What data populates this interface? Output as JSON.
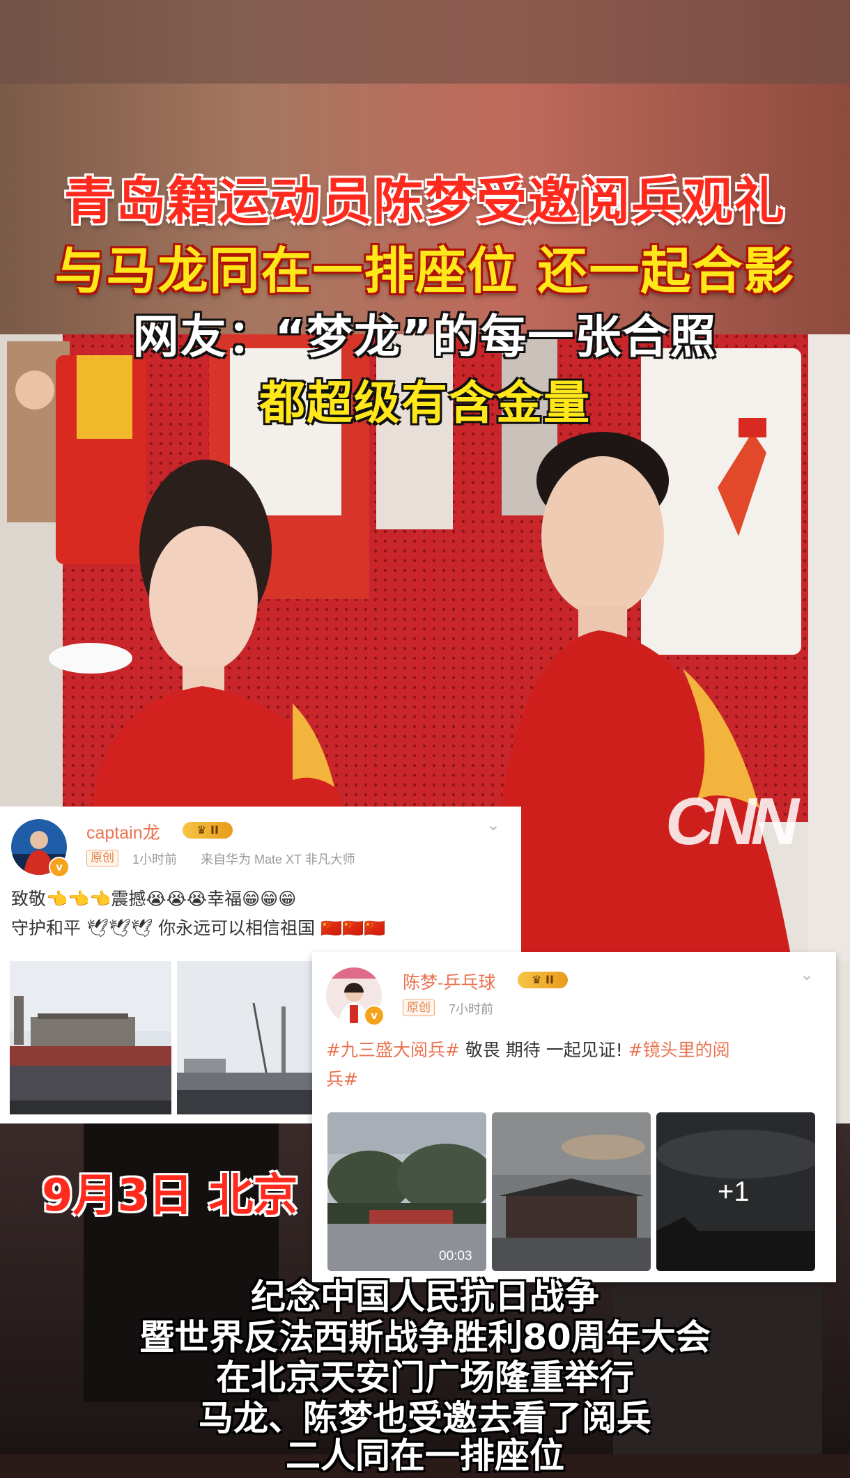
{
  "headline": {
    "line1": "青岛籍运动员陈梦受邀阅兵观礼",
    "line2": "与马龙同在一排座位 还一起合影",
    "line3": "网友：“梦龙”的每一张合照",
    "line4": "都超级有含金量"
  },
  "watermark": "CNN",
  "post1": {
    "username": "captain龙",
    "vip_level": "II",
    "verified_badge": "v",
    "original_tag": "原创",
    "time": "1小时前",
    "source": "来自华为 Mate XT 非凡大师",
    "line1_prefix": "致敬",
    "line1_emoji_a": "👈👈👈",
    "line1_mid": "震撼",
    "line1_emoji_b": "😭😭😭",
    "line1_mid2": "幸福",
    "line1_emoji_c": "😁😁😁",
    "line2_prefix": "守护和平",
    "line2_emoji": "🕊🕊🕊",
    "line2_mid": "你永远可以相信祖国",
    "line2_flags": "🇨🇳🇨🇳🇨🇳"
  },
  "post2": {
    "username": "陈梦-乒乓球",
    "vip_level": "II",
    "verified_badge": "v",
    "original_tag": "原创",
    "time": "7小时前",
    "hashtag1": "#九三盛大阅兵#",
    "text": " 敬畏 期待  一起见证! ",
    "hashtag2_a": "#镜头里的阅",
    "hashtag2_b": "兵#",
    "video_duration": "00:03",
    "more_count": "+1"
  },
  "location_caption": "9月3日 北京",
  "subtitles": [
    "纪念中国人民抗日战争",
    "暨世界反法西斯战争胜利80周年大会",
    "在北京天安门广场隆重举行",
    "马龙、陈梦也受邀去看了阅兵",
    "二人同在一排座位"
  ],
  "colors": {
    "headline_red": "#ff2a1e",
    "headline_yellow": "#ffe71a",
    "weibo_orange": "#eb7350"
  }
}
